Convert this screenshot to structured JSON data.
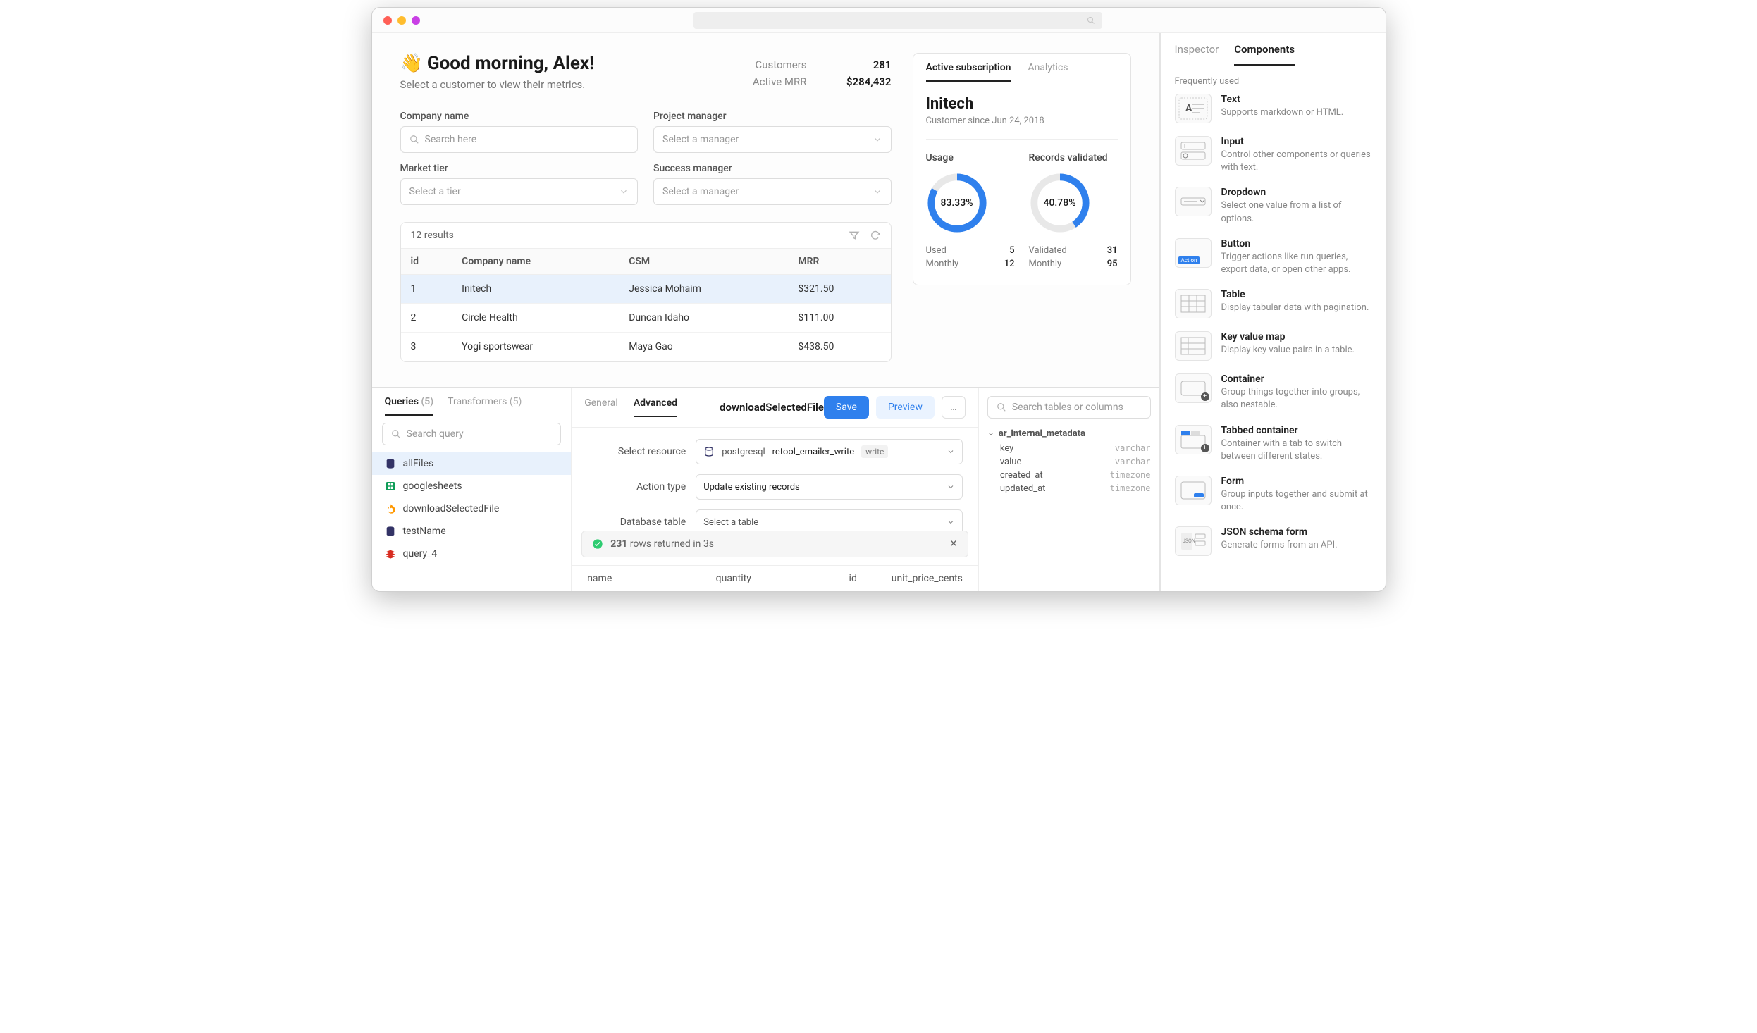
{
  "header": {
    "greeting": "Good morning, Alex!",
    "wave": "👋",
    "subtitle": "Select a customer to view their metrics.",
    "stats": [
      {
        "label": "Customers",
        "value": "281"
      },
      {
        "label": "Active MRR",
        "value": "$284,432"
      }
    ]
  },
  "filters": {
    "company_label": "Company name",
    "company_placeholder": "Search here",
    "pm_label": "Project manager",
    "pm_placeholder": "Select a manager",
    "tier_label": "Market tier",
    "tier_placeholder": "Select a tier",
    "sm_label": "Success manager",
    "sm_placeholder": "Select a manager"
  },
  "table": {
    "results_text": "12 results",
    "cols": [
      "id",
      "Company name",
      "CSM",
      "MRR"
    ],
    "rows": [
      {
        "id": "1",
        "company": "Initech",
        "csm": "Jessica Mohaim",
        "mrr": "$321.50",
        "selected": true
      },
      {
        "id": "2",
        "company": "Circle Health",
        "csm": "Duncan Idaho",
        "mrr": "$111.00"
      },
      {
        "id": "3",
        "company": "Yogi sportswear",
        "csm": "Maya Gao",
        "mrr": "$438.50"
      }
    ]
  },
  "detail": {
    "tabs": [
      "Active subscription",
      "Analytics"
    ],
    "title": "Initech",
    "since": "Customer since Jun 24, 2018",
    "usage": {
      "label": "Usage",
      "pct": "83.33%",
      "pct_num": 83.33,
      "rows": [
        {
          "k": "Used",
          "v": "5"
        },
        {
          "k": "Monthly",
          "v": "12"
        }
      ]
    },
    "records": {
      "label": "Records validated",
      "pct": "40.78%",
      "pct_num": 40.78,
      "rows": [
        {
          "k": "Validated",
          "v": "31"
        },
        {
          "k": "Monthly",
          "v": "95"
        }
      ]
    }
  },
  "bottom": {
    "left_tabs": [
      {
        "label": "Queries",
        "count": "(5)",
        "active": true
      },
      {
        "label": "Transformers",
        "count": "(5)"
      }
    ],
    "search_placeholder": "Search query",
    "queries": [
      {
        "name": "allFiles",
        "icon": "db",
        "selected": true
      },
      {
        "name": "googlesheets",
        "icon": "sheet"
      },
      {
        "name": "downloadSelectedFile",
        "icon": "fire"
      },
      {
        "name": "testName",
        "icon": "db"
      },
      {
        "name": "query_4",
        "icon": "redis"
      }
    ],
    "center_tabs": [
      "General",
      "Advanced"
    ],
    "center_title": "downloadSelectedFile",
    "save": "Save",
    "preview": "Preview",
    "more": "…",
    "form": {
      "resource_label": "Select resource",
      "resource_db": "postgresql",
      "resource_name": "retool_emailer_write",
      "resource_mode": "write",
      "action_label": "Action type",
      "action_value": "Update existing records",
      "table_label": "Database table",
      "table_placeholder": "Select a table"
    },
    "toast": {
      "count": "231",
      "text": "rows returned in 3s"
    },
    "result_cols": [
      "name",
      "quantity",
      "id",
      "unit_price_cents"
    ],
    "schema": {
      "search_placeholder": "Search tables or columns",
      "table": "ar_internal_metadata",
      "cols": [
        {
          "n": "key",
          "t": "varchar"
        },
        {
          "n": "value",
          "t": "varchar"
        },
        {
          "n": "created_at",
          "t": "timezone"
        },
        {
          "n": "updated_at",
          "t": "timezone"
        }
      ]
    }
  },
  "right_panel": {
    "tabs": [
      "Inspector",
      "Components"
    ],
    "section": "Frequently used",
    "components": [
      {
        "title": "Text",
        "desc": "Supports markdown or HTML.",
        "icon": "text"
      },
      {
        "title": "Input",
        "desc": "Control other components or queries with text.",
        "icon": "input"
      },
      {
        "title": "Dropdown",
        "desc": "Select one value from a list of options.",
        "icon": "dropdown"
      },
      {
        "title": "Button",
        "desc": "Trigger actions like run queries, export data, or open other apps.",
        "icon": "button"
      },
      {
        "title": "Table",
        "desc": "Display tabular data with pagination.",
        "icon": "table"
      },
      {
        "title": "Key value map",
        "desc": "Display key value pairs in a table.",
        "icon": "kvm"
      },
      {
        "title": "Container",
        "desc": "Group things together into groups, also nestable.",
        "icon": "container"
      },
      {
        "title": "Tabbed container",
        "desc": "Container with a tab to switch between different states.",
        "icon": "tabbed"
      },
      {
        "title": "Form",
        "desc": "Group inputs together and submit at once.",
        "icon": "form"
      },
      {
        "title": "JSON schema form",
        "desc": "Generate forms from an API.",
        "icon": "json"
      }
    ]
  }
}
